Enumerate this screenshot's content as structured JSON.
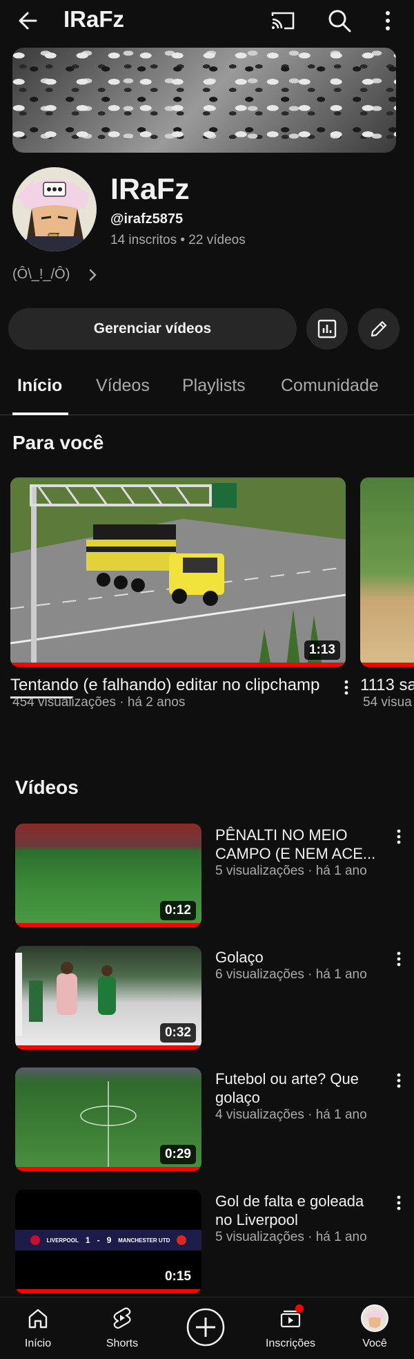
{
  "header": {
    "title": "IRaFz"
  },
  "channel": {
    "name": "IRaFz",
    "handle": "@irafz5875",
    "stats": "14 inscritos • 22 vídeos",
    "description": "(Ô\\_!_/Ô)"
  },
  "actions": {
    "manage_label": "Gerenciar vídeos"
  },
  "tabs": [
    {
      "label": "Início",
      "active": true
    },
    {
      "label": "Vídeos"
    },
    {
      "label": "Playlists"
    },
    {
      "label": "Comunidade"
    }
  ],
  "for_you": {
    "title": "Para você",
    "items": [
      {
        "title": "Tentando (e falhando) editar no clipchamp",
        "meta": "454 visualizações · há 2 anos",
        "duration": "1:13"
      },
      {
        "title": "1113 sa",
        "meta": "54 visua"
      }
    ]
  },
  "videos": {
    "title": "Vídeos",
    "items": [
      {
        "title_line1": "PÊNALTI NO MEIO",
        "title_line2": "CAMPO (E NEM ACE...",
        "meta": "5 visualizações · há 1 ano",
        "duration": "0:12"
      },
      {
        "title_line1": "Golaço",
        "title_line2": "",
        "meta": "6 visualizações · há 1 ano",
        "duration": "0:32"
      },
      {
        "title_line1": "Futebol ou arte? Que",
        "title_line2": "golaço",
        "meta": "4 visualizações · há 1 ano",
        "duration": "0:29"
      },
      {
        "title_line1": "Gol de falta e goleada",
        "title_line2": "no Liverpool",
        "meta": "5 visualizações · há 1 ano",
        "duration": "0:15"
      }
    ]
  },
  "scoreboard": {
    "home": "LIVERPOOL",
    "score_home": "1",
    "score_away": "9",
    "away": "MANCHESTER UTD"
  },
  "bottom_nav": [
    {
      "label": "Início"
    },
    {
      "label": "Shorts"
    },
    {
      "label": ""
    },
    {
      "label": "Inscrições"
    },
    {
      "label": "Você"
    }
  ],
  "colors": {
    "background": "#0f0f0f",
    "progress": "#ff0000",
    "button": "#272727",
    "secondary_text": "#aaaaaa"
  }
}
